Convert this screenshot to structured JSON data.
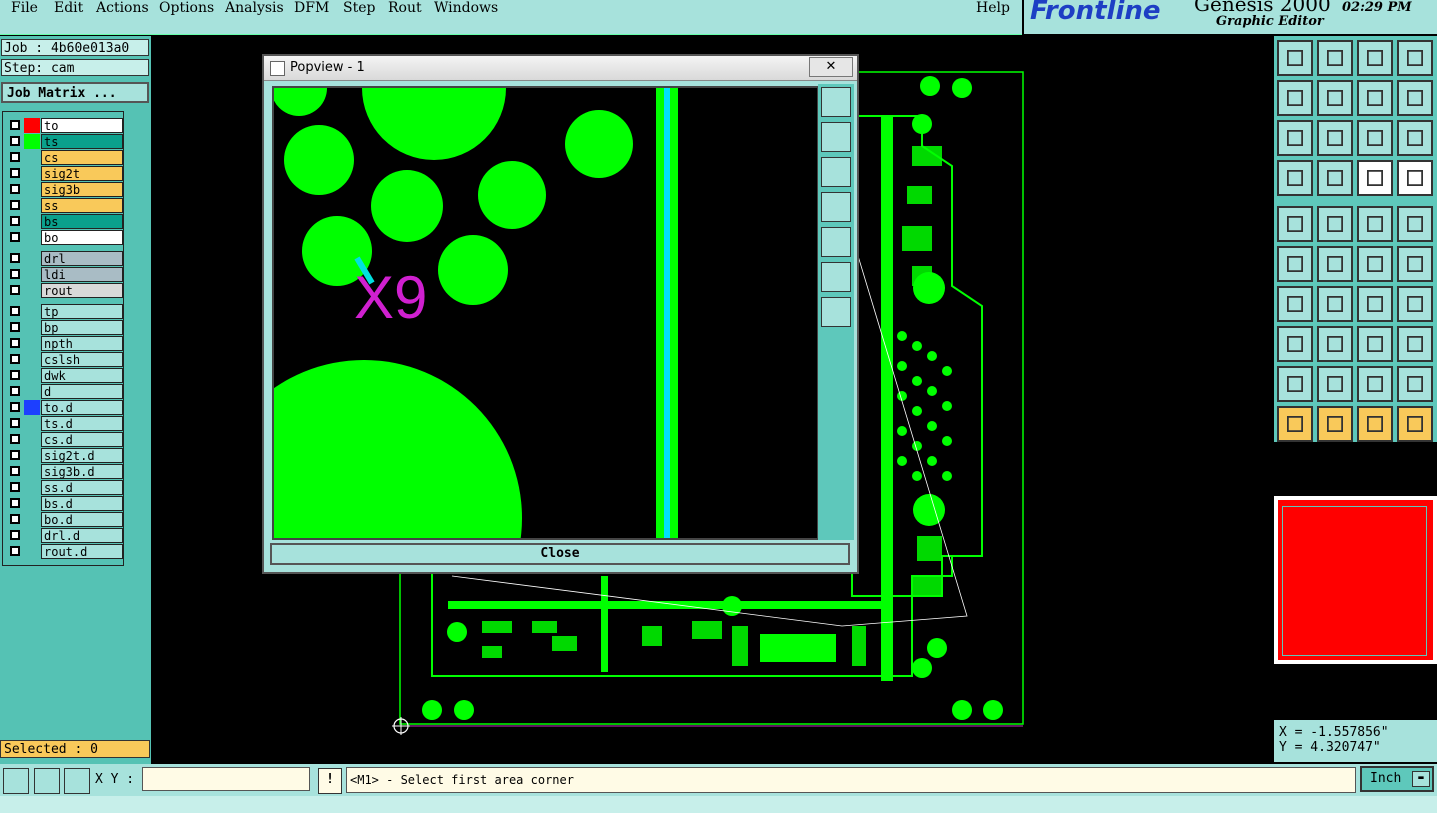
{
  "menu": [
    "File",
    "Edit",
    "Actions",
    "Options",
    "Analysis",
    "DFM",
    "Step",
    "Rout",
    "Windows"
  ],
  "help": "Help",
  "brand": {
    "logo": "Frontline",
    "product": "Genesis 2000",
    "subtitle": "Graphic Editor",
    "time": "02:29 PM"
  },
  "job": "Job : 4b60e013a0",
  "step": "Step: cam",
  "job_matrix": "Job Matrix ...",
  "layers_group1": [
    {
      "name": "to",
      "color": "#ffffff",
      "swatch": "#ff0000"
    },
    {
      "name": "ts",
      "color": "#0aa08c",
      "swatch": "#00ff00"
    },
    {
      "name": "cs",
      "color": "#f9c95a",
      "swatch": ""
    },
    {
      "name": "sig2t",
      "color": "#f9c95a",
      "swatch": ""
    },
    {
      "name": "sig3b",
      "color": "#f9c95a",
      "swatch": ""
    },
    {
      "name": "ss",
      "color": "#f9c95a",
      "swatch": ""
    },
    {
      "name": "bs",
      "color": "#0aa08c",
      "swatch": ""
    },
    {
      "name": "bo",
      "color": "#ffffff",
      "swatch": ""
    }
  ],
  "layers_group2": [
    "drl",
    "ldi",
    "rout"
  ],
  "layers_group3": [
    "tp",
    "bp",
    "npth",
    "cslsh",
    "dwk",
    "d",
    "to.d",
    "ts.d",
    "cs.d",
    "sig2t.d",
    "sig3b.d",
    "ss.d",
    "bs.d",
    "bo.d",
    "drl.d",
    "rout.d"
  ],
  "selected": "Selected : 0",
  "popup": {
    "title": "Popview - 1",
    "close_label": "Close",
    "marker_text": "X9"
  },
  "coords": {
    "x": "X = -1.557856\"",
    "y": "Y = 4.320747\""
  },
  "status": {
    "xy_label": "X Y :",
    "xy_value": "",
    "prompt": "<M1> - Select first area corner",
    "units": "Inch"
  },
  "colors": {
    "panel": "#a7e2dc",
    "green": "#00ff00",
    "red": "#ff0000",
    "magenta": "#d020d0"
  }
}
